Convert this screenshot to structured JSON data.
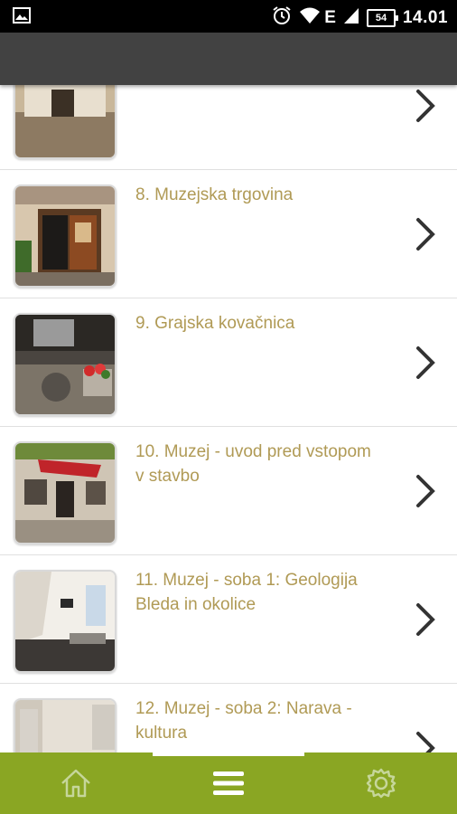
{
  "status_bar": {
    "time": "14.01",
    "battery_level": "54",
    "network_label": "E",
    "icons": [
      "image-notification-icon",
      "alarm-icon",
      "wifi-icon",
      "signal-icon",
      "battery-icon"
    ]
  },
  "list": {
    "items": [
      {
        "title": "",
        "thumbnail": "courtyard-photo"
      },
      {
        "title": "8. Muzejska trgovina",
        "thumbnail": "shop-door-photo"
      },
      {
        "title": "9. Grajska kovačnica",
        "thumbnail": "forge-photo"
      },
      {
        "title": "10. Muzej - uvod pred vstopom v stavbo",
        "thumbnail": "museum-entrance-photo"
      },
      {
        "title": "11. Muzej - soba 1: Geologija Bleda in okolice",
        "thumbnail": "museum-room-photo"
      },
      {
        "title": "12. Muzej - soba 2: Narava - kultura",
        "thumbnail": "museum-exhibit-photo"
      }
    ]
  },
  "bottom_nav": {
    "items": [
      {
        "icon": "home-icon",
        "active": false
      },
      {
        "icon": "menu-icon",
        "active": true
      },
      {
        "icon": "gear-icon",
        "active": false
      }
    ]
  },
  "colors": {
    "title_text": "#b09a55",
    "app_bar": "#424242",
    "bottom_nav": "#8aa623",
    "divider": "#e0e0e0"
  }
}
